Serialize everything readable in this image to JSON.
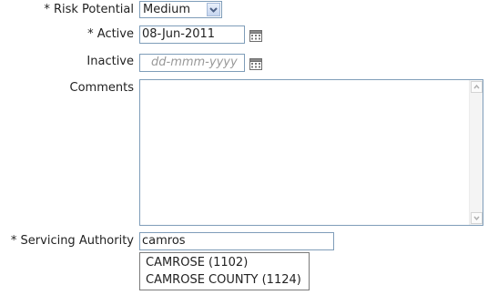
{
  "risk_potential": {
    "label": "* Risk Potential",
    "selected": "Medium"
  },
  "active": {
    "label": "* Active",
    "value": "08-Jun-2011"
  },
  "inactive": {
    "label": "Inactive",
    "placeholder": "dd-mmm-yyyy"
  },
  "comments": {
    "label": "Comments",
    "value": ""
  },
  "servicing_authority": {
    "label": "* Servicing Authority",
    "value": "camros",
    "suggestions": [
      "CAMROSE (1102)",
      "CAMROSE COUNTY (1124)"
    ]
  },
  "icons": {
    "calendar": "calendar-icon",
    "select_arrow": "chevron-down-icon",
    "scroll_up": "arrow-up-icon",
    "scroll_down": "arrow-down-icon"
  }
}
